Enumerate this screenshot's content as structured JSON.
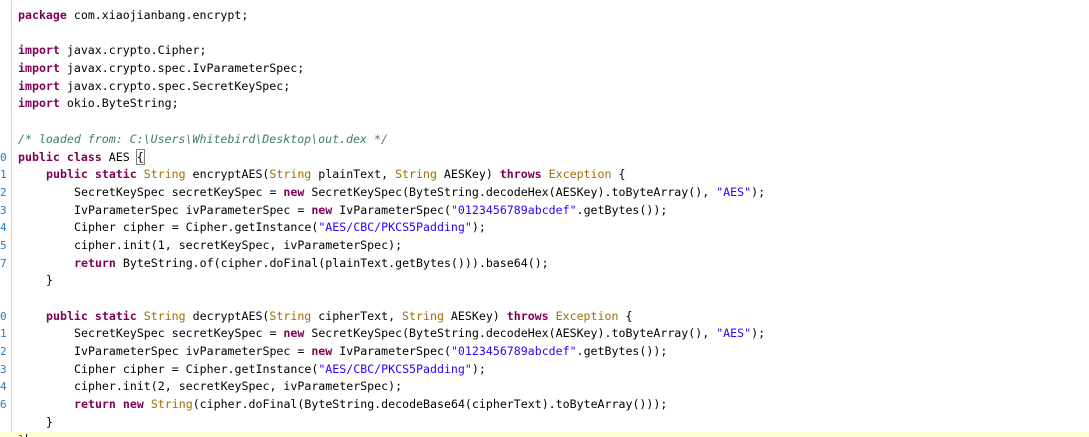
{
  "lines": [
    {
      "num": "",
      "tokens": [
        [
          "kw",
          "package"
        ],
        [
          "",
          " com.xiaojianbang.encrypt;"
        ]
      ]
    },
    {
      "num": "",
      "tokens": []
    },
    {
      "num": "",
      "tokens": [
        [
          "kw",
          "import"
        ],
        [
          "",
          " javax.crypto.Cipher;"
        ]
      ]
    },
    {
      "num": "",
      "tokens": [
        [
          "kw",
          "import"
        ],
        [
          "",
          " javax.crypto.spec.IvParameterSpec;"
        ]
      ]
    },
    {
      "num": "",
      "tokens": [
        [
          "kw",
          "import"
        ],
        [
          "",
          " javax.crypto.spec.SecretKeySpec;"
        ]
      ]
    },
    {
      "num": "",
      "tokens": [
        [
          "kw",
          "import"
        ],
        [
          "",
          " okio.ByteString;"
        ]
      ]
    },
    {
      "num": "",
      "tokens": []
    },
    {
      "num": "",
      "tokens": [
        [
          "cm",
          "/* loaded from: C:\\Users\\Whitebird\\Desktop\\out.dex */"
        ]
      ]
    },
    {
      "num": "0",
      "tokens": [
        [
          "kw",
          "public"
        ],
        [
          "",
          " "
        ],
        [
          "kw",
          "class"
        ],
        [
          "",
          " AES "
        ],
        [
          "brace",
          "{"
        ]
      ]
    },
    {
      "num": "1",
      "indent": 1,
      "tokens": [
        [
          "kw",
          "public"
        ],
        [
          "",
          " "
        ],
        [
          "kw",
          "static"
        ],
        [
          "",
          " "
        ],
        [
          "ty",
          "String"
        ],
        [
          "",
          " encryptAES("
        ],
        [
          "ty",
          "String"
        ],
        [
          "",
          " plainText, "
        ],
        [
          "ty",
          "String"
        ],
        [
          "",
          " AESKey) "
        ],
        [
          "kw",
          "throws"
        ],
        [
          "",
          " "
        ],
        [
          "ty",
          "Exception"
        ],
        [
          "",
          " {"
        ]
      ]
    },
    {
      "num": "2",
      "indent": 2,
      "tokens": [
        [
          "",
          "SecretKeySpec secretKeySpec = "
        ],
        [
          "kw",
          "new"
        ],
        [
          "",
          " SecretKeySpec(ByteString.decodeHex(AESKey).toByteArray(), "
        ],
        [
          "str",
          "\"AES\""
        ],
        [
          "",
          ");"
        ]
      ]
    },
    {
      "num": "3",
      "indent": 2,
      "tokens": [
        [
          "",
          "IvParameterSpec ivParameterSpec = "
        ],
        [
          "kw",
          "new"
        ],
        [
          "",
          " IvParameterSpec("
        ],
        [
          "str",
          "\"0123456789abcdef\""
        ],
        [
          "",
          ".getBytes());"
        ]
      ]
    },
    {
      "num": "4",
      "indent": 2,
      "tokens": [
        [
          "",
          "Cipher cipher = Cipher.getInstance("
        ],
        [
          "str",
          "\"AES/CBC/PKCS5Padding\""
        ],
        [
          "",
          ");"
        ]
      ]
    },
    {
      "num": "5",
      "indent": 2,
      "tokens": [
        [
          "",
          "cipher.init(1, secretKeySpec, ivParameterSpec);"
        ]
      ]
    },
    {
      "num": "7",
      "indent": 2,
      "tokens": [
        [
          "kw",
          "return"
        ],
        [
          "",
          " ByteString.of(cipher.doFinal(plainText.getBytes())).base64();"
        ]
      ]
    },
    {
      "num": "",
      "indent": 1,
      "tokens": [
        [
          "",
          "}"
        ]
      ]
    },
    {
      "num": "",
      "tokens": []
    },
    {
      "num": "0",
      "indent": 1,
      "tokens": [
        [
          "kw",
          "public"
        ],
        [
          "",
          " "
        ],
        [
          "kw",
          "static"
        ],
        [
          "",
          " "
        ],
        [
          "ty",
          "String"
        ],
        [
          "",
          " decryptAES("
        ],
        [
          "ty",
          "String"
        ],
        [
          "",
          " cipherText, "
        ],
        [
          "ty",
          "String"
        ],
        [
          "",
          " AESKey) "
        ],
        [
          "kw",
          "throws"
        ],
        [
          "",
          " "
        ],
        [
          "ty",
          "Exception"
        ],
        [
          "",
          " {"
        ]
      ]
    },
    {
      "num": "1",
      "indent": 2,
      "tokens": [
        [
          "",
          "SecretKeySpec secretKeySpec = "
        ],
        [
          "kw",
          "new"
        ],
        [
          "",
          " SecretKeySpec(ByteString.decodeHex(AESKey).toByteArray(), "
        ],
        [
          "str",
          "\"AES\""
        ],
        [
          "",
          ");"
        ]
      ]
    },
    {
      "num": "2",
      "indent": 2,
      "tokens": [
        [
          "",
          "IvParameterSpec ivParameterSpec = "
        ],
        [
          "kw",
          "new"
        ],
        [
          "",
          " IvParameterSpec("
        ],
        [
          "str",
          "\"0123456789abcdef\""
        ],
        [
          "",
          ".getBytes());"
        ]
      ]
    },
    {
      "num": "3",
      "indent": 2,
      "tokens": [
        [
          "",
          "Cipher cipher = Cipher.getInstance("
        ],
        [
          "str",
          "\"AES/CBC/PKCS5Padding\""
        ],
        [
          "",
          ");"
        ]
      ]
    },
    {
      "num": "4",
      "indent": 2,
      "tokens": [
        [
          "",
          "cipher.init(2, secretKeySpec, ivParameterSpec);"
        ]
      ]
    },
    {
      "num": "6",
      "indent": 2,
      "tokens": [
        [
          "kw",
          "return"
        ],
        [
          "",
          " "
        ],
        [
          "kw",
          "new"
        ],
        [
          "",
          " "
        ],
        [
          "ty",
          "String"
        ],
        [
          "",
          "(cipher.doFinal(ByteString.decodeBase64(cipherText).toByteArray()));"
        ]
      ]
    },
    {
      "num": "",
      "indent": 1,
      "tokens": [
        [
          "",
          "}"
        ]
      ]
    },
    {
      "num": "",
      "current": true,
      "tokens": [
        [
          "red",
          "}"
        ],
        [
          "caret",
          ""
        ]
      ]
    }
  ],
  "colors": {
    "keyword": "#7f0055",
    "type": "#a26d00",
    "string": "#2a00ff",
    "comment": "#3f7f5f",
    "line_number": "#2b7bbf",
    "current_line": "#ffffd5"
  }
}
